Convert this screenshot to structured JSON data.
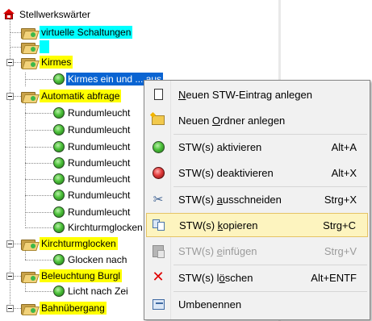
{
  "tree": {
    "root": "Stellwerkswärter",
    "items": [
      {
        "label": "virtuelle Schaltungen"
      },
      {
        "label": ""
      },
      {
        "label": "Kirmes"
      },
      {
        "label": "Kirmes ein und ... aus"
      },
      {
        "label": "Automatik abfrage"
      },
      {
        "label": "Rundumleucht"
      },
      {
        "label": "Rundumleucht"
      },
      {
        "label": "Rundumleucht"
      },
      {
        "label": "Rundumleucht"
      },
      {
        "label": "Rundumleucht"
      },
      {
        "label": "Rundumleucht"
      },
      {
        "label": "Rundumleucht"
      },
      {
        "label": "Kirchturmglocken"
      },
      {
        "label": "Glocken nach"
      },
      {
        "label": "Beleuchtung Burgl"
      },
      {
        "label": "Licht nach Zei"
      },
      {
        "label": "Bahnübergang"
      }
    ]
  },
  "menu": {
    "items": [
      {
        "pre": "",
        "u": "N",
        "post": "euen STW-Eintrag anlegen",
        "shortcut": "",
        "icon": "document-icon"
      },
      {
        "pre": "Neuen ",
        "u": "O",
        "post": "rdner anlegen",
        "shortcut": "",
        "icon": "folder-icon"
      },
      {
        "pre": "STW(s) aktivieren",
        "u": "",
        "post": "",
        "shortcut": "Alt+A",
        "icon": "green-ball-icon"
      },
      {
        "pre": "STW(s) deaktivieren",
        "u": "",
        "post": "",
        "shortcut": "Alt+X",
        "icon": "red-ball-icon"
      },
      {
        "pre": "STW(s) ",
        "u": "a",
        "post": "usschneiden",
        "shortcut": "Strg+X",
        "icon": "scissors-icon"
      },
      {
        "pre": "STW(s) ",
        "u": "k",
        "post": "opieren",
        "shortcut": "Strg+C",
        "icon": "copy-icon"
      },
      {
        "pre": "STW(s) ",
        "u": "e",
        "post": "infügen",
        "shortcut": "Strg+V",
        "icon": "paste-icon"
      },
      {
        "pre": "STW(s) l",
        "u": "ö",
        "post": "schen",
        "shortcut": "Alt+ENTF",
        "icon": "delete-icon"
      },
      {
        "pre": "Umbenennen",
        "u": "",
        "post": "",
        "shortcut": "",
        "icon": "rename-icon"
      }
    ]
  },
  "colors": {
    "highlight": "#ffff00",
    "cyan": "#00ffff",
    "selection": "#0a64d2",
    "menu_hover": "#fdf4bf"
  }
}
